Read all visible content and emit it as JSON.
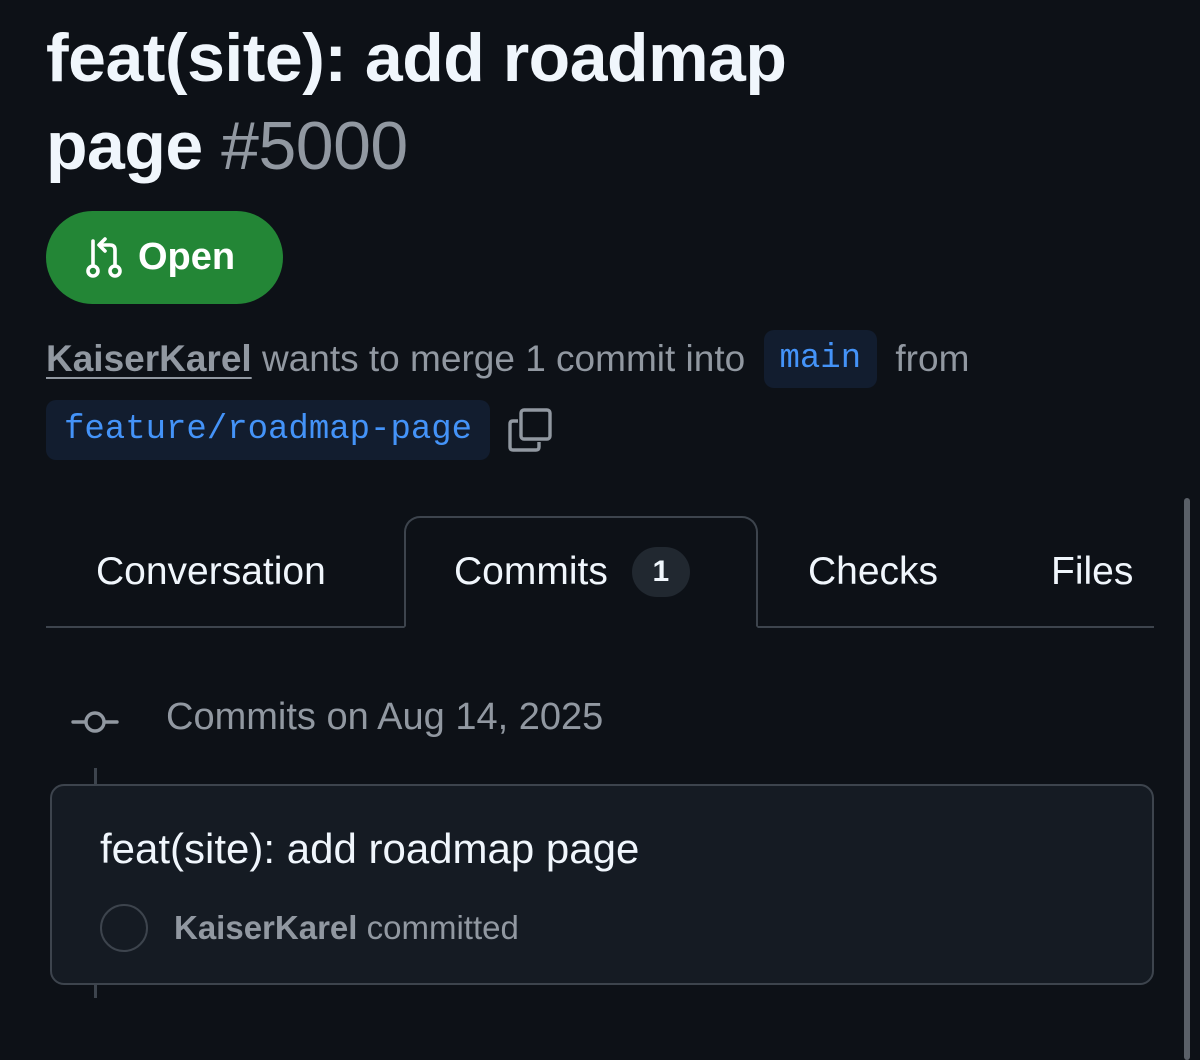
{
  "pull_request": {
    "title": "feat(site): add roadmap page",
    "number": "#5000",
    "state_label": "Open",
    "state_icon": "git-pull-request-icon",
    "author": "KaiserKarel",
    "merge_text": "wants to merge 1 commit into",
    "base_branch": "main",
    "from_text": "from",
    "head_branch": "feature/roadmap-page",
    "copy_icon": "copy-icon"
  },
  "tabs": [
    {
      "label": "Conversation",
      "active": false
    },
    {
      "label": "Commits",
      "count": "1",
      "active": true
    },
    {
      "label": "Checks",
      "active": false
    },
    {
      "label": "Files",
      "active": false
    }
  ],
  "commits_section": {
    "group_heading": "Commits on Aug 14, 2025",
    "group_icon": "git-commit-icon",
    "commits": [
      {
        "message": "feat(site): add roadmap page",
        "author": "KaiserKarel",
        "action": "committed"
      }
    ]
  },
  "colors": {
    "background": "#0d1117",
    "open_badge": "#238636",
    "branch_text": "#4493f8",
    "branch_bg": "#121d2f",
    "muted_text": "#9198a1",
    "border": "#3d444d"
  }
}
